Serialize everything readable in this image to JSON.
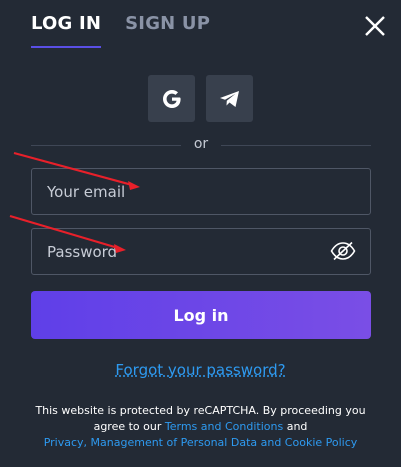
{
  "tabs": {
    "login": "LOG IN",
    "signup": "SIGN UP"
  },
  "social": {
    "google_icon": "google-icon",
    "telegram_icon": "telegram-icon"
  },
  "divider": {
    "text": "or"
  },
  "email": {
    "placeholder": "Your email",
    "value": ""
  },
  "password": {
    "placeholder": "Password",
    "value": ""
  },
  "login_button": "Log in",
  "forgot_link": "Forgot your password?",
  "legal": {
    "line1": "This website is protected by reCAPTCHA. By proceeding you",
    "line2_prefix": "agree to our",
    "terms_link": "Terms and Conditions",
    "and": "and",
    "privacy_link": "Privacy, Management of Personal Data and Cookie Policy"
  },
  "colors": {
    "background": "#232a35",
    "accent": "#5a4fe6",
    "link": "#2e9af0",
    "annotation_arrow": "#e8202a"
  }
}
